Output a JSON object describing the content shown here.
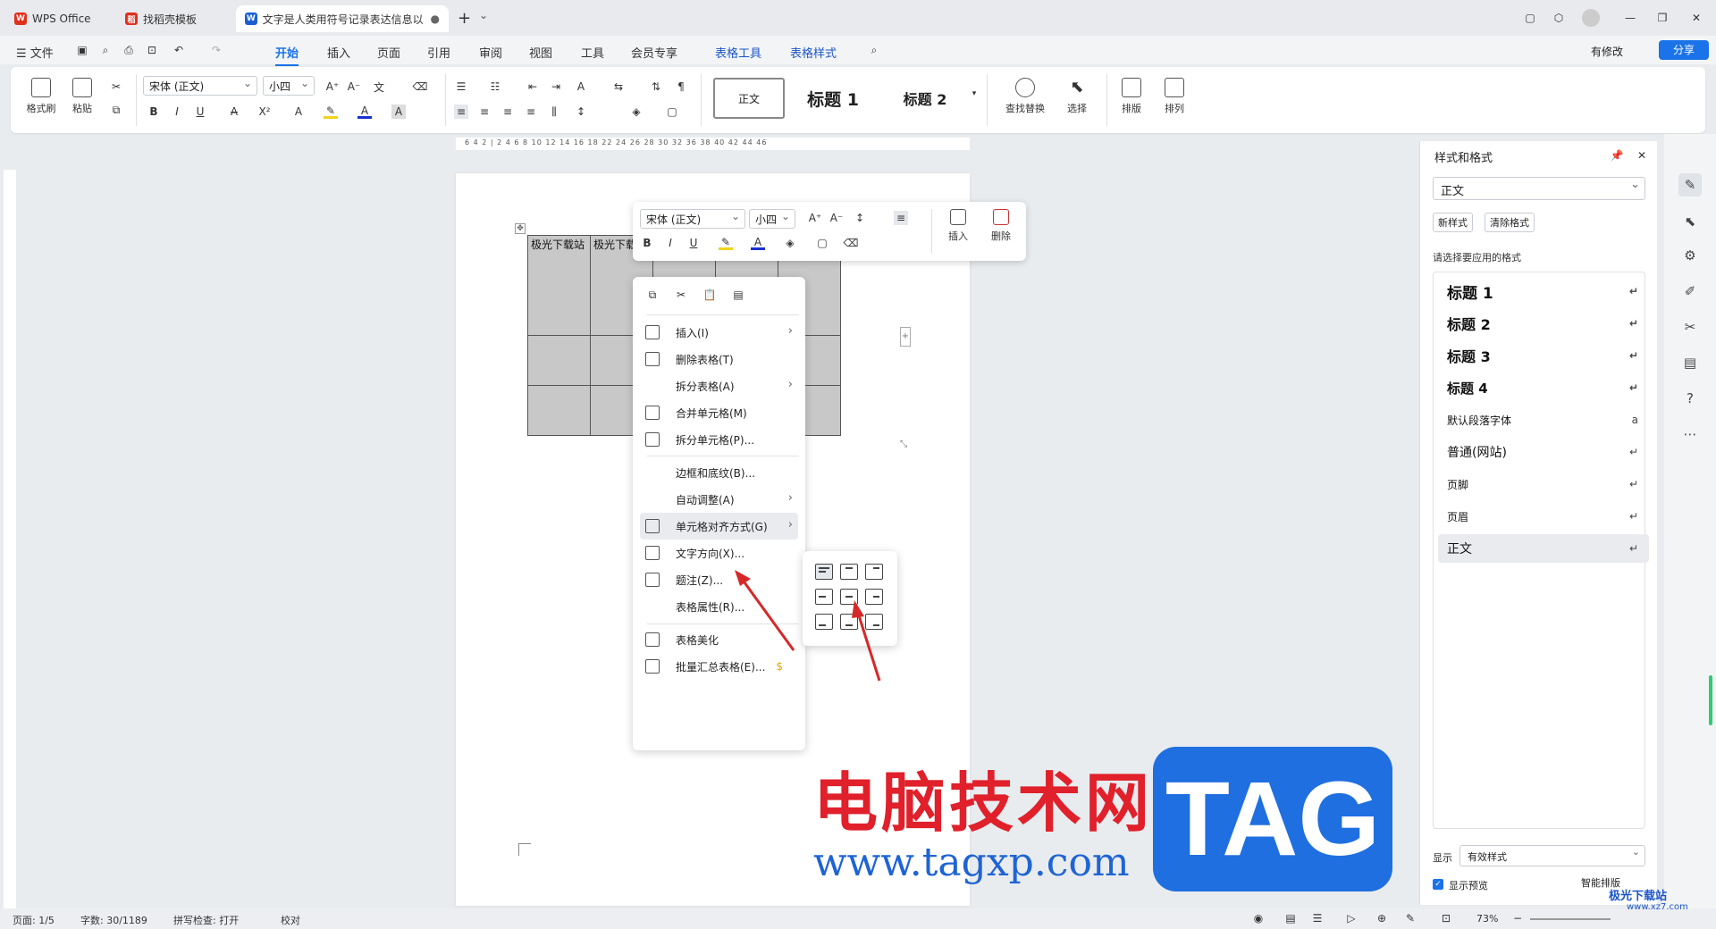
{
  "titlebar": {
    "tabs": [
      {
        "label": "WPS Office",
        "icon": "wps-logo-icon"
      },
      {
        "label": "找稻壳模板",
        "icon": "docer-icon"
      },
      {
        "label": "文字是人类用符号记录表达信息以",
        "icon": "word-doc-icon"
      }
    ],
    "new_tab": "+",
    "tab_menu": "⌄"
  },
  "menubar": {
    "file": "☰ 文件",
    "items": [
      "开始",
      "插入",
      "页面",
      "引用",
      "审阅",
      "视图",
      "工具",
      "会员专享",
      "表格工具",
      "表格样式"
    ],
    "active_index": 0,
    "has_changes": "有修改",
    "share": "分享"
  },
  "ribbon": {
    "format_painter": "格式刷",
    "paste": "粘贴",
    "font_name": "宋体 (正文)",
    "font_size": "小四",
    "styles": [
      "正文",
      "标题 1",
      "标题 2"
    ],
    "find_replace": "查找替换",
    "select": "选择",
    "layout": "排版",
    "arrange": "排列"
  },
  "ruler": {
    "marks": "6 4 2 | 2 4 6 8 10 12 14 16 18 22 24 26 28 30 32 36 38 40 42 44 46"
  },
  "table": {
    "header_cells": [
      "极光下载站",
      "极光下载站"
    ]
  },
  "floatbar": {
    "font_name": "宋体 (正文)",
    "font_size": "小四",
    "insert": "插入",
    "delete": "删除"
  },
  "context_menu": {
    "items": [
      {
        "label": "插入(I)",
        "submenu": true
      },
      {
        "label": "删除表格(T)",
        "submenu": false
      },
      {
        "label": "拆分表格(A)",
        "submenu": true
      },
      {
        "label": "合并单元格(M)",
        "submenu": false
      },
      {
        "label": "拆分单元格(P)...",
        "submenu": false
      },
      {
        "label": "边框和底纹(B)...",
        "submenu": false
      },
      {
        "label": "自动调整(A)",
        "submenu": true
      },
      {
        "label": "单元格对齐方式(G)",
        "submenu": true
      },
      {
        "label": "文字方向(X)...",
        "submenu": false
      },
      {
        "label": "题注(Z)...",
        "submenu": false
      },
      {
        "label": "表格属性(R)...",
        "submenu": false
      },
      {
        "label": "表格美化",
        "submenu": false
      },
      {
        "label": "批量汇总表格(E)...",
        "submenu": false
      }
    ],
    "highlighted_index": 7
  },
  "style_panel": {
    "title": "样式和格式",
    "current_style": "正文",
    "new_style": "新样式",
    "clear_format": "清除格式",
    "prompt": "请选择要应用的格式",
    "styles": [
      "标题 1",
      "标题 2",
      "标题 3",
      "标题 4",
      "默认段落字体",
      "普通(网站)",
      "页脚",
      "页眉",
      "正文"
    ],
    "show_label": "显示",
    "show_value": "有效样式",
    "preview": "显示预览",
    "smart_layout": "智能排版"
  },
  "statusbar": {
    "page": "页面: 1/5",
    "words": "字数: 30/1189",
    "spell": "拼写检查: 打开",
    "proof": "校对",
    "zoom": "73%"
  },
  "watermark": {
    "cn": "电脑技术网",
    "url": "www.tagxp.com",
    "tag": "TAG",
    "site": "极光下载站",
    "site_url": "www.xz7.com"
  },
  "colors": {
    "accent": "#1a73e8",
    "arrow": "#d62828",
    "watermark_red": "#e0202a",
    "watermark_blue": "#1f64d4"
  }
}
